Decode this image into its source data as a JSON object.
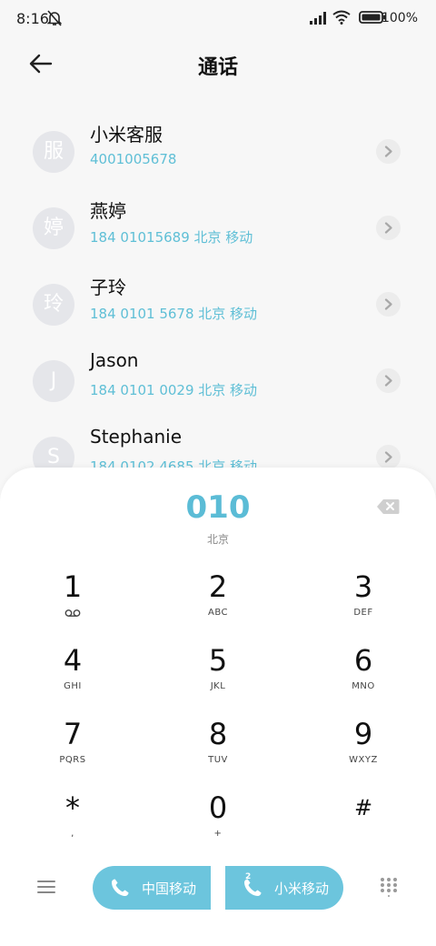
{
  "status_bar": {
    "time": "8:16",
    "battery": "100%"
  },
  "header": {
    "title": "通话"
  },
  "contacts": [
    {
      "avatar": "服",
      "name": "小米客服",
      "number": "4001005678"
    },
    {
      "avatar": "婷",
      "name": "燕婷",
      "number": "184 01015689  北京 移动"
    },
    {
      "avatar": "玲",
      "name": "子玲",
      "number": "184 0101 5678  北京 移动"
    },
    {
      "avatar": "J",
      "name": "Jason",
      "number": "184 0101 0029  北京 移动"
    },
    {
      "avatar": "S",
      "name": "Stephanie",
      "number": "184 0102 4685  北京 移动"
    }
  ],
  "dialer": {
    "input": "010",
    "region": "北京",
    "keys": [
      {
        "digit": "1",
        "letters": ""
      },
      {
        "digit": "2",
        "letters": "ABC"
      },
      {
        "digit": "3",
        "letters": "DEF"
      },
      {
        "digit": "4",
        "letters": "GHI"
      },
      {
        "digit": "5",
        "letters": "JKL"
      },
      {
        "digit": "6",
        "letters": "MNO"
      },
      {
        "digit": "7",
        "letters": "PQRS"
      },
      {
        "digit": "8",
        "letters": "TUV"
      },
      {
        "digit": "9",
        "letters": "WXYZ"
      },
      {
        "digit": "*",
        "letters": ","
      },
      {
        "digit": "0",
        "letters": "+"
      },
      {
        "digit": "#",
        "letters": ""
      }
    ],
    "call_sim1_label": "中国移动",
    "call_sim2_label": "小米移动",
    "sim2_badge": "2"
  },
  "colors": {
    "accent": "#5bbcd6",
    "call_button": "#6cc5dd"
  },
  "icons": {
    "back": "arrow-left-icon",
    "chevron": "chevron-right-icon",
    "delete": "backspace-icon",
    "menu": "menu-icon",
    "phone": "phone-icon",
    "keypad": "keypad-grid-icon",
    "voicemail": "voicemail-icon"
  }
}
